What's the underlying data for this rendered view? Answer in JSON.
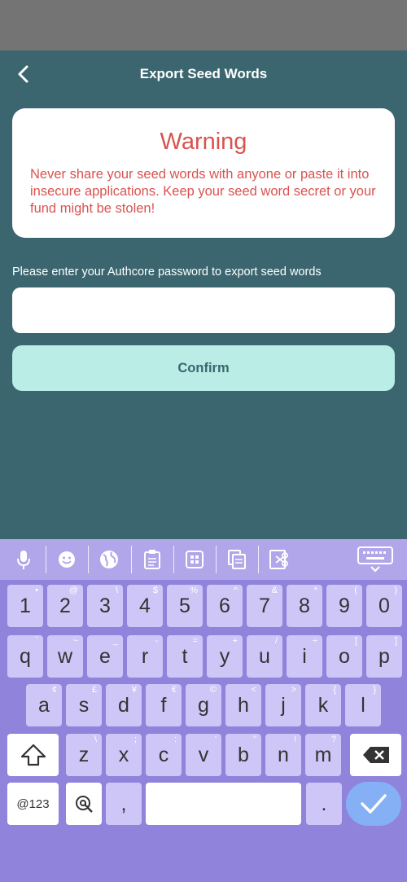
{
  "header": {
    "title": "Export Seed Words",
    "back_icon": "back-arrow-icon"
  },
  "warning": {
    "title": "Warning",
    "message": "Never share your seed words with anyone or paste it into insecure applications. Keep your seed word secret or your fund might be stolen!"
  },
  "password": {
    "label": "Please enter your Authcore password to export seed words",
    "value": "",
    "placeholder": ""
  },
  "confirm_label": "Confirm",
  "colors": {
    "background": "#3b6670",
    "status_bar": "#747474",
    "warning_text": "#d9534f",
    "confirm_bg": "#b9ede6",
    "keyboard_bg": "#8f83db",
    "keyboard_toolbar": "#b1a6ea",
    "key_bg": "#cdc6f6",
    "enter_key": "#85b0f5"
  },
  "keyboard": {
    "toolbar_icons": [
      "microphone-icon",
      "emoji-icon",
      "globe-icon",
      "clipboard-icon",
      "grid-icon",
      "copy-icon",
      "cut-icon",
      "hide-keyboard-icon"
    ],
    "row1": [
      {
        "k": "1",
        "s": "•"
      },
      {
        "k": "2",
        "s": "@"
      },
      {
        "k": "3",
        "s": "\\"
      },
      {
        "k": "4",
        "s": "$"
      },
      {
        "k": "5",
        "s": "%"
      },
      {
        "k": "6",
        "s": "^"
      },
      {
        "k": "7",
        "s": "&"
      },
      {
        "k": "8",
        "s": "*"
      },
      {
        "k": "9",
        "s": "("
      },
      {
        "k": "0",
        "s": ")"
      }
    ],
    "row2": [
      {
        "k": "q",
        "s": "`"
      },
      {
        "k": "w",
        "s": "~"
      },
      {
        "k": "e",
        "s": "_"
      },
      {
        "k": "r",
        "s": "-"
      },
      {
        "k": "t",
        "s": "="
      },
      {
        "k": "y",
        "s": "+"
      },
      {
        "k": "u",
        "s": "/"
      },
      {
        "k": "i",
        "s": "÷"
      },
      {
        "k": "o",
        "s": "["
      },
      {
        "k": "p",
        "s": "]"
      }
    ],
    "row3": [
      {
        "k": "a",
        "s": "¢"
      },
      {
        "k": "s",
        "s": "£"
      },
      {
        "k": "d",
        "s": "¥"
      },
      {
        "k": "f",
        "s": "€"
      },
      {
        "k": "g",
        "s": "©"
      },
      {
        "k": "h",
        "s": "<"
      },
      {
        "k": "j",
        "s": ">"
      },
      {
        "k": "k",
        "s": "{"
      },
      {
        "k": "l",
        "s": "}"
      }
    ],
    "row4": [
      {
        "k": "z",
        "s": "\\"
      },
      {
        "k": "x",
        "s": ";"
      },
      {
        "k": "c",
        "s": ":"
      },
      {
        "k": "v",
        "s": "'"
      },
      {
        "k": "b",
        "s": "\""
      },
      {
        "k": "n",
        "s": "!"
      },
      {
        "k": "m",
        "s": "?"
      }
    ],
    "symbols_label": "@123",
    "comma": ",",
    "period": ".",
    "shift_icon": "shift-icon",
    "backspace_icon": "backspace-icon",
    "at_icon": "at-search-icon",
    "enter_icon": "checkmark-icon"
  }
}
